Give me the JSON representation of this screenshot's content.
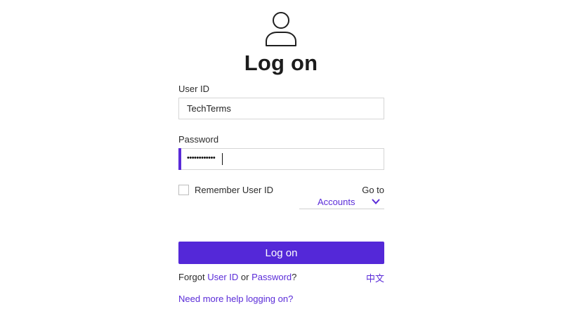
{
  "header": {
    "title": "Log on",
    "icon": "user-icon"
  },
  "form": {
    "user_id_label": "User ID",
    "user_id_value": "TechTerms",
    "password_label": "Password",
    "password_masked": "••••••••••••",
    "remember_label": "Remember User ID",
    "remember_checked": false,
    "goto_label": "Go to",
    "goto_selected": "Accounts",
    "submit_label": "Log on"
  },
  "footer": {
    "forgot_prefix": "Forgot",
    "forgot_user_id": "User ID",
    "forgot_or": "or",
    "forgot_password": "Password",
    "forgot_suffix": "?",
    "language_link": "中文",
    "help_link": "Need more help logging on?"
  },
  "colors": {
    "accent": "#5428d8",
    "link": "#5a2bd8",
    "border": "#d6d6d6"
  }
}
